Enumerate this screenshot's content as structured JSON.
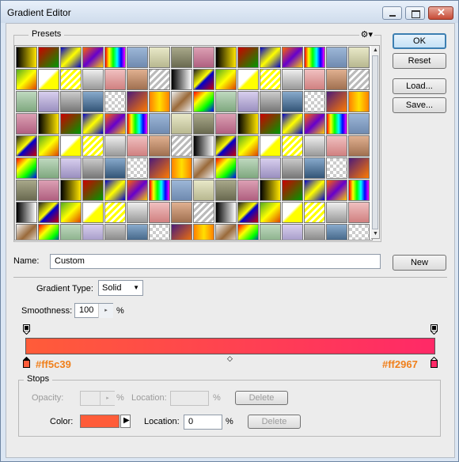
{
  "window": {
    "title": "Gradient Editor"
  },
  "presets": {
    "label": "Presets"
  },
  "buttons": {
    "ok": "OK",
    "reset": "Reset",
    "load": "Load...",
    "save": "Save...",
    "new": "New"
  },
  "name": {
    "label": "Name:",
    "value": "Custom"
  },
  "gradient": {
    "type_label": "Gradient Type:",
    "type_value": "Solid",
    "smoothness_label": "Smoothness:",
    "smoothness_value": "100",
    "smoothness_unit": "%",
    "start_color": "#ff5c39",
    "end_color": "#ff2967",
    "start_hex_text": "#ff5c39",
    "end_hex_text": "#ff2967"
  },
  "stops": {
    "label": "Stops",
    "opacity_label": "Opacity:",
    "opacity_unit": "%",
    "location_label": "Location:",
    "location_unit": "%",
    "delete_label": "Delete",
    "color_label": "Color:",
    "color_location_label": "Location:",
    "color_location_value": "0",
    "color_location_unit": "%",
    "color_delete_label": "Delete"
  },
  "icons": {
    "gear": "gear-icon",
    "scroll_up": "scroll-up-icon",
    "scroll_down": "scroll-down-icon"
  }
}
